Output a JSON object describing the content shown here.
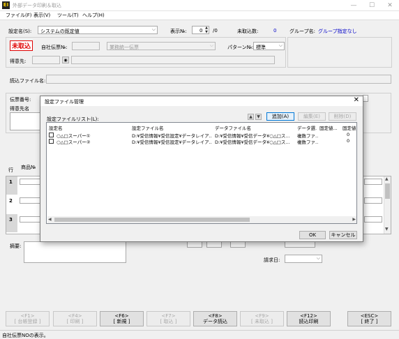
{
  "window": {
    "title": "外部データ印刷＆取込",
    "icon_text": "EI",
    "minimize": "—",
    "maximize": "☐",
    "close": "✕"
  },
  "menu": [
    "ファイル(F)",
    "表示(V)",
    "ツール(T)",
    "ヘルプ(H)"
  ],
  "form": {
    "setting_label": "設定名(S):",
    "setting_value": "システムの既定値",
    "display_no_label": "表示№:",
    "display_no_value": "0",
    "display_no_total": "/0",
    "unimported_label": "未取込数:",
    "unimported_value": "0",
    "group_label": "グループ名:",
    "group_value": "グループ指定なし",
    "status_badge": "未取込",
    "own_slip_label": "自社伝票№:",
    "biz_type_value": "業務統一伝票",
    "pattern_label": "パターン№:",
    "pattern_value": "標準",
    "customer_label": "得意先:",
    "read_file_label": "読込ファイル名:",
    "slip_no_label": "伝票番号:",
    "customer_name_label": "得意先名",
    "row_label": "行",
    "product_label": "商品№",
    "rows": [
      "1",
      "2",
      "3"
    ],
    "remarks_label": "摘要:",
    "billing_date_label": "請求日:"
  },
  "dialog": {
    "title": "設定ファイル管理",
    "list_label": "設定ファイルリスト(L):",
    "add_button": "追加(A)",
    "edit_button": "編集(E)",
    "delete_button": "削除(D)",
    "columns": [
      "設定名",
      "設定ファイル名",
      "データファイル名",
      "データ選...",
      "固定値...",
      "固定値"
    ],
    "rows": [
      {
        "name": "○△□スーパー①",
        "setting_file": "D:¥受信情報¥受信設定¥データレイア...",
        "data_file": "D:¥受信情報¥受信データ¥○△□ス...",
        "data_sel": "複数ファ...",
        "fixed": "0"
      },
      {
        "name": "○△□スーパー②",
        "setting_file": "D:¥受信情報¥受信設定¥データレイア...",
        "data_file": "D:¥受信情報¥受信データ¥○△□ス...",
        "data_sel": "複数ファ...",
        "fixed": "0"
      }
    ],
    "ok_button": "OK",
    "cancel_button": "キャンセル"
  },
  "fkeys": [
    {
      "key": "<F1>",
      "label": "[ 台帳登録 ]",
      "enabled": false
    },
    {
      "key": "<F4>",
      "label": "[ 印刷 ]",
      "enabled": false
    },
    {
      "key": "<F6>",
      "label": "[ 新規 ]",
      "enabled": true
    },
    {
      "key": "<F7>",
      "label": "[ 取込 ]",
      "enabled": false
    },
    {
      "key": "<F8>",
      "label": "データ読込",
      "enabled": true
    },
    {
      "key": "<F9>",
      "label": "[ 未取込 ]",
      "enabled": false
    },
    {
      "key": "<F12>",
      "label": "読込印刷",
      "enabled": true
    },
    {
      "key": "<ESC>",
      "label": "[ 終了 ]",
      "enabled": true
    }
  ],
  "status_text": "自社伝票NOの表示。",
  "colors": {
    "badge_red": "#e00000",
    "link_blue": "#0000c8",
    "accent_border": "#0078d7"
  }
}
